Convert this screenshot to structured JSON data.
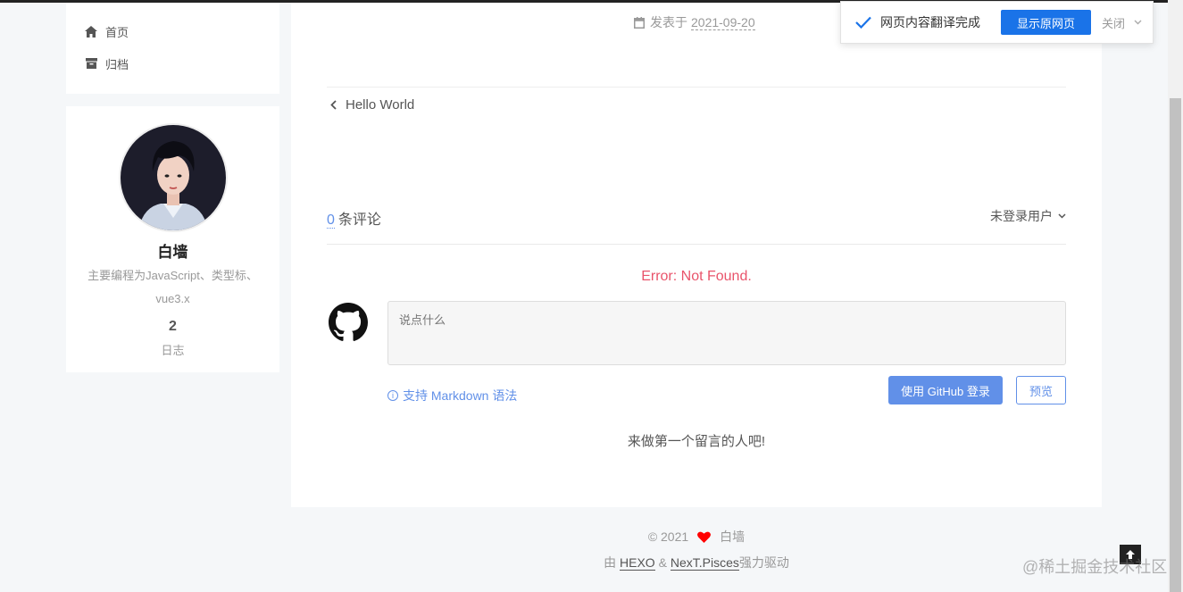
{
  "menu": {
    "items": [
      {
        "label": "首页",
        "icon": "home-icon"
      },
      {
        "label": "归档",
        "icon": "archive-icon"
      }
    ]
  },
  "author": {
    "name": "白墙",
    "description": "主要编程为JavaScript、类型标、vue3.x",
    "posts_count": "2",
    "posts_label": "日志"
  },
  "post": {
    "meta_prefix": "发表于",
    "date": "2021-09-20",
    "prev_title": "Hello World"
  },
  "comments": {
    "count": "0",
    "count_suffix": "条评论",
    "user_menu": "未登录用户",
    "error": "Error: Not Found.",
    "placeholder": "说点什么",
    "markdown_tip": "支持 Markdown 语法",
    "login_button": "使用 GitHub 登录",
    "preview_button": "预览",
    "empty_text": "来做第一个留言的人吧!"
  },
  "footer": {
    "copyright": "© 2021",
    "author": "白墙",
    "powered_prefix": "由",
    "hexo": "HEXO",
    "amp": "&",
    "theme": "NexT.Pisces",
    "powered_suffix": "强力驱动"
  },
  "translate": {
    "message": "网页内容翻译完成",
    "show_original": "显示原网页",
    "close": "关闭"
  },
  "watermark": "@稀土掘金技术社区",
  "colors": {
    "accent": "#6190e8",
    "error": "#e9546b",
    "heart": "#ff0000",
    "translate_button": "#1a73e8"
  }
}
